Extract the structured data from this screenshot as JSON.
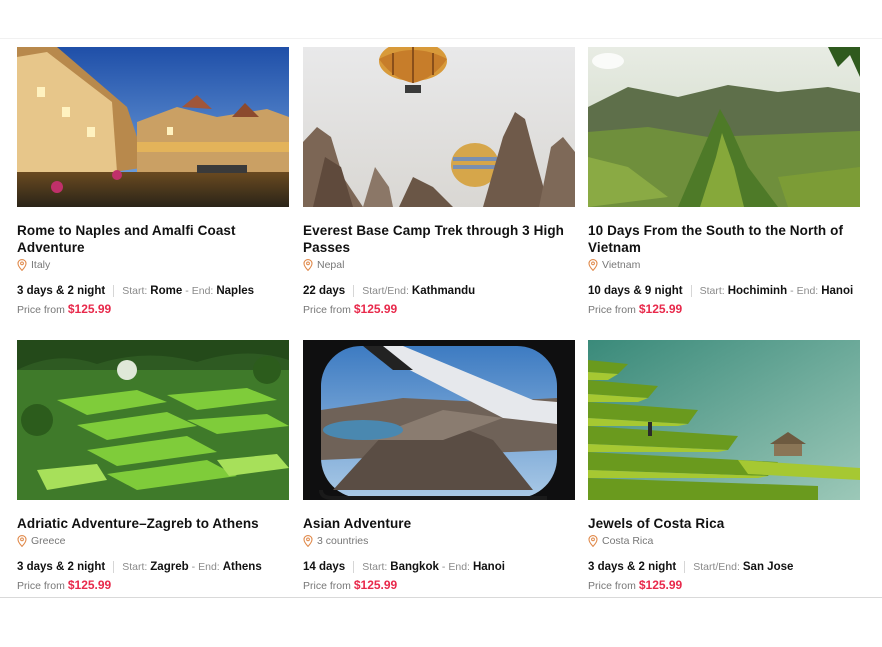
{
  "tours": [
    {
      "title": "Rome to Naples and Amalfi Coast Adventure",
      "location": "Italy",
      "duration": "3 days & 2 night",
      "start_label": "Start:",
      "start": "Rome",
      "end_label": "End:",
      "end": "Naples",
      "price_label": "Price from",
      "price": "$125.99"
    },
    {
      "title": "Everest Base Camp Trek through 3 High Passes",
      "location": "Nepal",
      "duration": "22 days",
      "start_label": "Start/End:",
      "start": "Kathmandu",
      "price_label": "Price from",
      "price": "$125.99"
    },
    {
      "title": "10 Days From the South to the North of Vietnam",
      "location": "Vietnam",
      "duration": "10 days & 9 night",
      "start_label": "Start:",
      "start": "Hochiminh",
      "end_label": "End:",
      "end": "Hanoi",
      "price_label": "Price from",
      "price": "$125.99"
    },
    {
      "title": "Adriatic Adventure–Zagreb to Athens",
      "location": "Greece",
      "duration": "3 days & 2 night",
      "start_label": "Start:",
      "start": "Zagreb",
      "end_label": "End:",
      "end": "Athens",
      "price_label": "Price from",
      "price": "$125.99"
    },
    {
      "title": "Asian Adventure",
      "location": "3 countries",
      "duration": "14 days",
      "start_label": "Start:",
      "start": "Bangkok",
      "end_label": "End:",
      "end": "Hanoi",
      "price_label": "Price from",
      "price": "$125.99"
    },
    {
      "title": "Jewels of Costa Rica",
      "location": "Costa Rica",
      "duration": "3 days & 2 night",
      "start_label": "Start/End:",
      "start": "San Jose",
      "price_label": "Price from",
      "price": "$125.99"
    }
  ],
  "colors": {
    "price": "#e8294b",
    "pin": "#e0894a",
    "muted": "#777777"
  },
  "icons": {
    "location": "map-pin-icon"
  }
}
